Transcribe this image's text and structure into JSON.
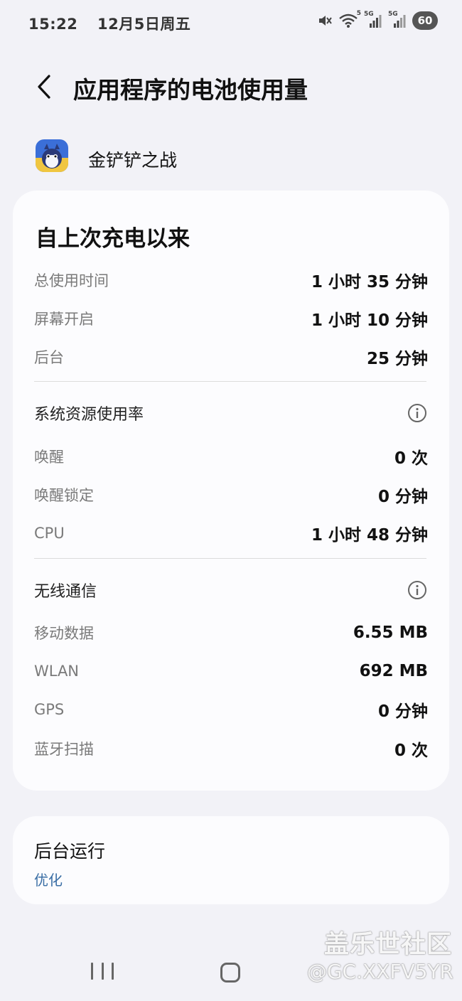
{
  "status_bar": {
    "time": "15:22",
    "date": "12月5日周五",
    "battery": "60",
    "net_5g_1": "5G",
    "net_5g_2": "5G",
    "wifi_sub": "5"
  },
  "header": {
    "title": "应用程序的电池使用量"
  },
  "app": {
    "name": "金铲铲之战"
  },
  "usage_card": {
    "title": "自上次充电以来",
    "time_rows": [
      {
        "label": "总使用时间",
        "value": "1 小时 35 分钟"
      },
      {
        "label": "屏幕开启",
        "value": "1 小时 10 分钟"
      },
      {
        "label": "后台",
        "value": "25 分钟"
      }
    ],
    "resource_section": {
      "title": "系统资源使用率",
      "rows": [
        {
          "label": "唤醒",
          "value": "0 次"
        },
        {
          "label": "唤醒锁定",
          "value": "0 分钟"
        },
        {
          "label": "CPU",
          "value": "1 小时 48 分钟"
        }
      ]
    },
    "wireless_section": {
      "title": "无线通信",
      "rows": [
        {
          "label": "移动数据",
          "value": "6.55 MB"
        },
        {
          "label": "WLAN",
          "value": "692 MB"
        },
        {
          "label": "GPS",
          "value": "0 分钟"
        },
        {
          "label": "蓝牙扫描",
          "value": "0 次"
        }
      ]
    }
  },
  "background_card": {
    "title": "后台运行",
    "subtitle": "优化"
  },
  "watermark": {
    "line1": "盖乐世社区",
    "line2": "@GC.XXFV5YR"
  },
  "icons": {
    "back": "chevron-left-icon",
    "info": "info-icon",
    "mute": "mute-icon",
    "wifi": "wifi-icon",
    "signal": "signal-icon"
  },
  "colors": {
    "background": "#f2f2f7",
    "card": "#fcfcfe",
    "link": "#3a6ea5",
    "label": "#7a7a7a"
  }
}
